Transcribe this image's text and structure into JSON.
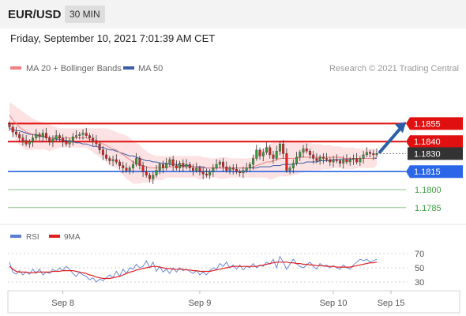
{
  "header": {
    "symbol": "EUR/USD",
    "timeframe": "30 MIN"
  },
  "timestamp": "Friday, September 10, 2021 7:01:39 AM CET",
  "legend": {
    "ma20": {
      "label": "MA 20 + Bollinger Bands",
      "color": "#f08080"
    },
    "ma50": {
      "label": "MA 50",
      "color": "#3a5ea8"
    },
    "rsi": {
      "label": "RSI",
      "color": "#5b7fd6"
    },
    "ma9": {
      "label": "9MA",
      "color": "#e02020"
    }
  },
  "credit": "Research © 2021 Trading Central",
  "colors": {
    "resistance": "#e01010",
    "support": "#2c66e8",
    "target": "#3d9a3d",
    "bull": "#3d9a3d",
    "bear": "#e02020",
    "band": "#fbd8d8",
    "arrow": "#2a5fa8",
    "current_bg": "#333333"
  },
  "chart_data": [
    {
      "type": "candlestick",
      "ylim": [
        1.177,
        1.19
      ],
      "x_ticks": [
        "Sep 8",
        "Sep 9",
        "Sep 10",
        "Sep 15"
      ],
      "levels": [
        {
          "label": "1.1855",
          "value": 1.1855,
          "kind": "resistance"
        },
        {
          "label": "1.1840",
          "value": 1.184,
          "kind": "resistance"
        },
        {
          "label": "1.1830",
          "value": 1.183,
          "kind": "current"
        },
        {
          "label": "1.1815",
          "value": 1.1815,
          "kind": "support"
        },
        {
          "label": "1.1800",
          "value": 1.18,
          "kind": "target"
        },
        {
          "label": "1.1785",
          "value": 1.1785,
          "kind": "target"
        }
      ],
      "close": [
        1.1852,
        1.1848,
        1.1846,
        1.1843,
        1.1841,
        1.1838,
        1.184,
        1.1843,
        1.1846,
        1.1844,
        1.1847,
        1.1843,
        1.184,
        1.1842,
        1.1845,
        1.1843,
        1.184,
        1.1838,
        1.1841,
        1.1844,
        1.1845,
        1.1846,
        1.1847,
        1.1845,
        1.1843,
        1.1841,
        1.1838,
        1.1833,
        1.1829,
        1.1826,
        1.1824,
        1.1825,
        1.1823,
        1.182,
        1.1818,
        1.1816,
        1.1818,
        1.1821,
        1.1826,
        1.182,
        1.1815,
        1.1812,
        1.1809,
        1.1812,
        1.1816,
        1.1821,
        1.1818,
        1.1822,
        1.1825,
        1.182,
        1.1818,
        1.1822,
        1.1819,
        1.1821,
        1.1818,
        1.1816,
        1.1818,
        1.1815,
        1.1813,
        1.1812,
        1.1815,
        1.1818,
        1.1821,
        1.1823,
        1.1819,
        1.1816,
        1.1818,
        1.1817,
        1.1815,
        1.1814,
        1.1816,
        1.1818,
        1.1821,
        1.1826,
        1.1833,
        1.1828,
        1.1831,
        1.1835,
        1.1829,
        1.1826,
        1.1832,
        1.1838,
        1.183,
        1.1816,
        1.1818,
        1.1822,
        1.1827,
        1.1831,
        1.1834,
        1.1832,
        1.1829,
        1.1826,
        1.1824,
        1.1827,
        1.1826,
        1.1825,
        1.1823,
        1.1825,
        1.1824,
        1.1822,
        1.1825,
        1.1823,
        1.1825,
        1.1826,
        1.1823,
        1.1826,
        1.1829,
        1.1831,
        1.183,
        1.1829,
        1.183
      ],
      "ma20": [
        1.1862,
        1.1858,
        1.1855,
        1.1852,
        1.185,
        1.1848,
        1.1847,
        1.1846,
        1.1846,
        1.1845,
        1.1845,
        1.1844,
        1.1843,
        1.1843,
        1.1843,
        1.1843,
        1.1843,
        1.1843,
        1.1843,
        1.1843,
        1.1843,
        1.1843,
        1.1843,
        1.1843,
        1.1842,
        1.1841,
        1.184,
        1.1839,
        1.1838,
        1.1837,
        1.1835,
        1.1834,
        1.1833,
        1.1831,
        1.1829,
        1.1827,
        1.1825,
        1.1823,
        1.1822,
        1.1821,
        1.182,
        1.1819,
        1.1818,
        1.1818,
        1.1818,
        1.1818,
        1.1818,
        1.1819,
        1.1819,
        1.1819,
        1.1819,
        1.1819,
        1.1819,
        1.1819,
        1.1819,
        1.1819,
        1.1819,
        1.1818,
        1.1818,
        1.1818,
        1.1818,
        1.1818,
        1.1818,
        1.1818,
        1.1818,
        1.1818,
        1.1818,
        1.1818,
        1.1818,
        1.1818,
        1.1818,
        1.1818,
        1.1818,
        1.1819,
        1.182,
        1.1821,
        1.1822,
        1.1823,
        1.1823,
        1.1824,
        1.1825,
        1.1826,
        1.1826,
        1.1826,
        1.1826,
        1.1826,
        1.1826,
        1.1827,
        1.1827,
        1.1827,
        1.1827,
        1.1827,
        1.1827,
        1.1827,
        1.1827,
        1.1827,
        1.1827,
        1.1827,
        1.1827,
        1.1827,
        1.1826,
        1.1826,
        1.1826,
        1.1826,
        1.1826,
        1.1826,
        1.1826,
        1.1826,
        1.1826,
        1.1826,
        1.1827
      ],
      "ma50": [
        1.1851,
        1.185,
        1.1849,
        1.1849,
        1.1848,
        1.1847,
        1.1846,
        1.1846,
        1.1845,
        1.1845,
        1.1844,
        1.1844,
        1.1843,
        1.1843,
        1.1842,
        1.1842,
        1.1841,
        1.1841,
        1.184,
        1.184,
        1.1839,
        1.1839,
        1.1838,
        1.1838,
        1.1837,
        1.1836,
        1.1836,
        1.1835,
        1.1835,
        1.1834,
        1.1833,
        1.1833,
        1.1832,
        1.1831,
        1.183,
        1.1829,
        1.1828,
        1.1828,
        1.1827,
        1.1826,
        1.1825,
        1.1824,
        1.1824,
        1.1823,
        1.1823,
        1.1822,
        1.1822,
        1.1822,
        1.1821,
        1.1821,
        1.1821,
        1.182,
        1.182,
        1.182,
        1.182,
        1.1819,
        1.1819,
        1.1819,
        1.1819,
        1.1818,
        1.1818,
        1.1818,
        1.1818,
        1.1818,
        1.1818,
        1.1818,
        1.1818,
        1.1818,
        1.1818,
        1.1818,
        1.1818,
        1.1818,
        1.1818,
        1.1818,
        1.1818,
        1.1819,
        1.1819,
        1.1819,
        1.1819,
        1.182,
        1.182,
        1.182,
        1.1821,
        1.1821,
        1.1821,
        1.1821,
        1.1822,
        1.1822,
        1.1822,
        1.1823,
        1.1823,
        1.1823,
        1.1823,
        1.1824,
        1.1824,
        1.1824,
        1.1824,
        1.1825,
        1.1825,
        1.1825,
        1.1825,
        1.1825,
        1.1825,
        1.1826,
        1.1826,
        1.1826,
        1.1826,
        1.1826,
        1.1826,
        1.1826,
        1.1826
      ],
      "bb_upper": [
        1.1873,
        1.1871,
        1.1869,
        1.1867,
        1.1865,
        1.1863,
        1.1861,
        1.1859,
        1.1858,
        1.1857,
        1.1856,
        1.1855,
        1.1854,
        1.1853,
        1.1852,
        1.1851,
        1.1851,
        1.1851,
        1.1851,
        1.1851,
        1.1851,
        1.1851,
        1.1851,
        1.1851,
        1.1851,
        1.1851,
        1.1851,
        1.1851,
        1.1851,
        1.1851,
        1.185,
        1.1849,
        1.1848,
        1.1847,
        1.1846,
        1.1845,
        1.1843,
        1.1841,
        1.1839,
        1.1837,
        1.1834,
        1.1832,
        1.183,
        1.1829,
        1.1828,
        1.1828,
        1.1828,
        1.1828,
        1.1828,
        1.1828,
        1.1828,
        1.1828,
        1.1828,
        1.1828,
        1.1828,
        1.1828,
        1.1828,
        1.1828,
        1.1827,
        1.1827,
        1.1826,
        1.1826,
        1.1826,
        1.1827,
        1.1827,
        1.1827,
        1.1826,
        1.1826,
        1.1826,
        1.1826,
        1.1826,
        1.1826,
        1.1826,
        1.1828,
        1.183,
        1.1832,
        1.1834,
        1.1836,
        1.1838,
        1.1839,
        1.184,
        1.1841,
        1.1841,
        1.1841,
        1.1841,
        1.184,
        1.184,
        1.184,
        1.1839,
        1.1839,
        1.1839,
        1.1838,
        1.1838,
        1.1838,
        1.1837,
        1.1837,
        1.1837,
        1.1836,
        1.1836,
        1.1836,
        1.1835,
        1.1835,
        1.1835,
        1.1835,
        1.1834,
        1.1834,
        1.1834,
        1.1834,
        1.1834,
        1.1834,
        1.1834
      ],
      "bb_lower": [
        1.1851,
        1.1845,
        1.1841,
        1.1837,
        1.1835,
        1.1833,
        1.1833,
        1.1833,
        1.1834,
        1.1833,
        1.1834,
        1.1833,
        1.1832,
        1.1833,
        1.1834,
        1.1835,
        1.1835,
        1.1835,
        1.1835,
        1.1835,
        1.1835,
        1.1835,
        1.1835,
        1.1835,
        1.1833,
        1.1831,
        1.1829,
        1.1827,
        1.1825,
        1.1823,
        1.182,
        1.1819,
        1.1818,
        1.1815,
        1.1812,
        1.1809,
        1.1807,
        1.1805,
        1.1805,
        1.1805,
        1.1806,
        1.1806,
        1.1806,
        1.1807,
        1.1808,
        1.1808,
        1.1808,
        1.181,
        1.181,
        1.181,
        1.181,
        1.181,
        1.181,
        1.181,
        1.181,
        1.181,
        1.181,
        1.1808,
        1.1809,
        1.1809,
        1.181,
        1.181,
        1.181,
        1.1809,
        1.1809,
        1.1809,
        1.181,
        1.181,
        1.181,
        1.181,
        1.181,
        1.181,
        1.181,
        1.181,
        1.181,
        1.181,
        1.181,
        1.181,
        1.1808,
        1.1809,
        1.181,
        1.1811,
        1.1811,
        1.1811,
        1.1811,
        1.1812,
        1.1812,
        1.1814,
        1.1815,
        1.1815,
        1.1815,
        1.1816,
        1.1816,
        1.1816,
        1.1817,
        1.1817,
        1.1817,
        1.1818,
        1.1818,
        1.1818,
        1.1817,
        1.1817,
        1.1817,
        1.1817,
        1.1818,
        1.1818,
        1.1818,
        1.1818,
        1.1818,
        1.1818,
        1.182
      ]
    },
    {
      "type": "line",
      "ylim": [
        20,
        80
      ],
      "y_ticks": [
        70,
        50,
        30
      ],
      "series": [
        {
          "name": "RSI",
          "values": [
            58,
            44,
            41,
            46,
            40,
            44,
            41,
            48,
            42,
            48,
            40,
            44,
            42,
            48,
            45,
            50,
            46,
            52,
            48,
            42,
            38,
            44,
            40,
            38,
            33,
            36,
            30,
            34,
            32,
            36,
            40,
            36,
            45,
            38,
            48,
            42,
            50,
            48,
            55,
            50,
            52,
            60,
            50,
            58,
            45,
            52,
            44,
            48,
            42,
            50,
            44,
            50,
            46,
            48,
            45,
            42,
            46,
            40,
            44,
            40,
            46,
            50,
            48,
            56,
            52,
            58,
            50,
            54,
            48,
            54,
            47,
            52,
            50,
            56,
            50,
            54,
            52,
            58,
            55,
            62,
            50,
            66,
            58,
            48,
            55,
            62,
            56,
            52,
            50,
            54,
            58,
            52,
            48,
            56,
            52,
            54,
            50,
            53,
            50,
            48,
            54,
            50,
            48,
            54,
            58,
            62,
            60,
            62,
            58,
            60,
            62
          ]
        },
        {
          "name": "9MA",
          "values": [
            52,
            48,
            45,
            44,
            44,
            44,
            43,
            43,
            44,
            44,
            44,
            44,
            44,
            45,
            45,
            45,
            46,
            46,
            46,
            46,
            45,
            44,
            43,
            42,
            40,
            39,
            37,
            36,
            35,
            35,
            35,
            36,
            37,
            38,
            40,
            42,
            44,
            45,
            47,
            48,
            49,
            50,
            51,
            52,
            52,
            51,
            50,
            49,
            49,
            48,
            48,
            48,
            48,
            47,
            47,
            46,
            46,
            45,
            45,
            45,
            45,
            46,
            47,
            48,
            49,
            50,
            51,
            52,
            52,
            52,
            52,
            52,
            52,
            52,
            52,
            53,
            54,
            55,
            56,
            57,
            58,
            58,
            58,
            58,
            57,
            57,
            56,
            56,
            55,
            55,
            54,
            54,
            53,
            53,
            53,
            52,
            52,
            52,
            51,
            51,
            51,
            51,
            51,
            52,
            53,
            54,
            55,
            56,
            57,
            57,
            58
          ]
        }
      ]
    }
  ]
}
